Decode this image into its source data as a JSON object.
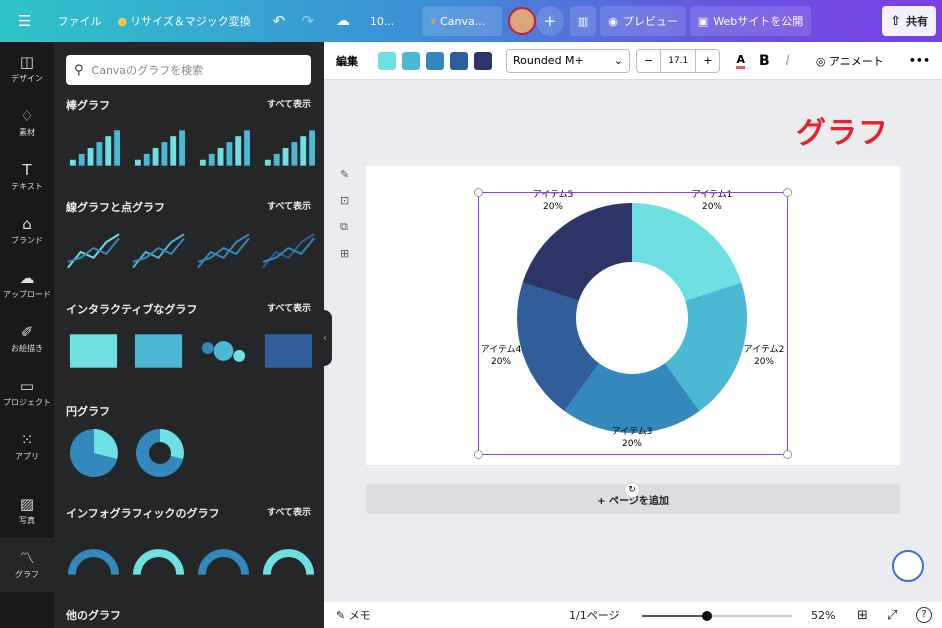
{
  "topbar": {
    "file": "ファイル",
    "resize": "リサイズ＆マジック変換",
    "doc_title": "10...",
    "canva_label": "Canva...",
    "preview": "プレビュー",
    "publish": "Webサイトを公開",
    "share": "共有"
  },
  "rail": [
    {
      "label": "デザイン",
      "icon": "layout-icon"
    },
    {
      "label": "素材",
      "icon": "elements-icon"
    },
    {
      "label": "テキスト",
      "icon": "text-icon"
    },
    {
      "label": "ブランド",
      "icon": "brand-icon"
    },
    {
      "label": "アップロード",
      "icon": "upload-icon"
    },
    {
      "label": "お絵描き",
      "icon": "draw-icon"
    },
    {
      "label": "プロジェクト",
      "icon": "folder-icon"
    },
    {
      "label": "アプリ",
      "icon": "apps-icon"
    },
    {
      "label": "写真",
      "icon": "photo-icon"
    },
    {
      "label": "グラフ",
      "icon": "chart-icon"
    }
  ],
  "panel": {
    "search_placeholder": "Canvaのグラフを検索",
    "see_all": "すべて表示",
    "sections": [
      {
        "title": "棒グラフ"
      },
      {
        "title": "線グラフと点グラフ"
      },
      {
        "title": "インタラクティブなグラフ"
      },
      {
        "title": "円グラフ"
      },
      {
        "title": "インフォグラフィックのグラフ"
      },
      {
        "title": "他のグラフ"
      }
    ]
  },
  "toolbar": {
    "edit": "編集",
    "colors": [
      "#6ee0e4",
      "#4bb8d4",
      "#3389bb",
      "#2f5e98",
      "#2d3468"
    ],
    "font": "Rounded M+",
    "font_size": "17.1",
    "bold": "B",
    "italic": "I",
    "animate": "アニメート",
    "more": "•••"
  },
  "canvas": {
    "heading": "グラフ",
    "add_page": "+ ページを追加"
  },
  "chart_data": {
    "type": "pie",
    "variant": "donut",
    "categories": [
      "アイテム1",
      "アイテム2",
      "アイテム3",
      "アイテム4",
      "アイテム5"
    ],
    "values": [
      20,
      20,
      20,
      20,
      20
    ],
    "labels": [
      "20%",
      "20%",
      "20%",
      "20%",
      "20%"
    ],
    "colors": [
      "#6ee0e4",
      "#4bb8d4",
      "#3389bb",
      "#2f5e98",
      "#2d3468"
    ]
  },
  "bottombar": {
    "notes": "メモ",
    "page": "1/1ページ",
    "zoom": "52%",
    "zoom_fraction": 0.43
  }
}
